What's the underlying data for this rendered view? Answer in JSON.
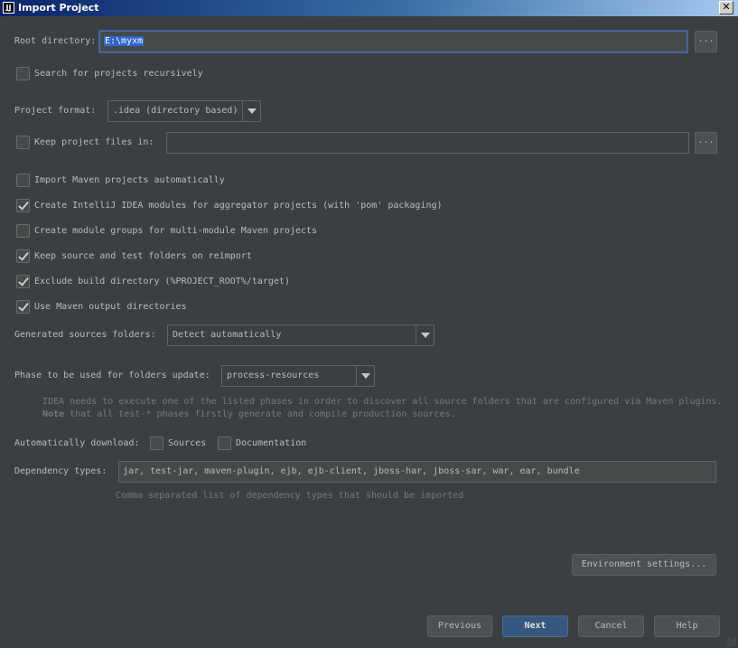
{
  "window": {
    "title": "Import Project"
  },
  "root_directory": {
    "label": "Root directory:",
    "value": "E:\\myxm",
    "browse_label": "..."
  },
  "search_recursive": {
    "label": "Search for projects recursively",
    "checked": false
  },
  "project_format": {
    "label": "Project format:",
    "selected": ".idea (directory based)"
  },
  "keep_project_files": {
    "label": "Keep project files in:",
    "checked": false,
    "value": "",
    "browse_label": "..."
  },
  "options": [
    {
      "label": "Import Maven projects automatically",
      "checked": false
    },
    {
      "label": "Create IntelliJ IDEA modules for aggregator projects (with 'pom' packaging)",
      "checked": true
    },
    {
      "label": "Create module groups for multi-module Maven projects",
      "checked": false
    },
    {
      "label": "Keep source and test folders on reimport",
      "checked": true
    },
    {
      "label": "Exclude build directory (%PROJECT_ROOT%/target)",
      "checked": true
    },
    {
      "label": "Use Maven output directories",
      "checked": true
    }
  ],
  "generated_sources": {
    "label": "Generated sources folders:",
    "selected": "Detect automatically"
  },
  "phase": {
    "label": "Phase to be used for folders update:",
    "selected": "process-resources",
    "hint_line1": "IDEA needs to execute one of the listed phases in order to discover all source folders that are configured via Maven plugins.",
    "hint_note": "Note",
    "hint_line2": " that all test-* phases firstly generate and compile production sources."
  },
  "auto_download": {
    "label": "Automatically download:",
    "sources_label": "Sources",
    "sources_checked": false,
    "docs_label": "Documentation",
    "docs_checked": false
  },
  "dependency_types": {
    "label": "Dependency types:",
    "value": "jar, test-jar, maven-plugin, ejb, ejb-client, jboss-har, jboss-sar, war, ear, bundle",
    "hint": "Comma separated list of dependency types that should be imported"
  },
  "buttons": {
    "env_settings": "Environment settings...",
    "previous": "Previous",
    "next": "Next",
    "cancel": "Cancel",
    "help": "Help"
  },
  "colors": {
    "background": "#3c3f41",
    "accent": "#365880",
    "selection": "#2f65ca"
  }
}
